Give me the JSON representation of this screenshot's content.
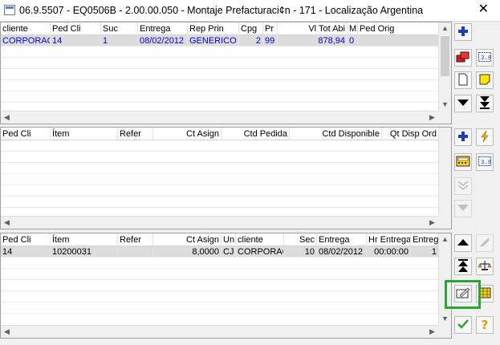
{
  "window": {
    "title": "06.9.5507 - EQ0506B - 2.00.00.050 - Montaje Prefacturaci¢n - 171 - Localização Argentina",
    "close_glyph": "✕"
  },
  "grid_top": {
    "headers": [
      "cliente",
      "Ped Cli",
      "Suc",
      "Entrega",
      "Rep Prin",
      "Cpg",
      "Pr",
      "Vl Tot Abi",
      "M",
      "Ped Orig"
    ],
    "rows": [
      [
        "CORPORAC",
        "14",
        "1",
        "08/02/2012",
        "GENERICO",
        "2",
        "99",
        "878,94",
        "0",
        ""
      ]
    ]
  },
  "grid_middle": {
    "headers": [
      "Ped Cli",
      "Ítem",
      "Refer",
      "Ct Asign",
      "Ctd Pedida",
      "Ctd Disponible",
      "Qt Disp Ord"
    ],
    "rows": []
  },
  "grid_bottom": {
    "headers": [
      "Ped Cli",
      "Ítem",
      "Refer",
      "Ct Asign",
      "Un",
      "cliente",
      "Sec",
      "Entrega",
      "Hr Entrega",
      "Entreg"
    ],
    "rows": [
      [
        "14",
        "10200031",
        "",
        "8,0000",
        "CJ",
        "CORPORAC",
        "10",
        "08/02/2012",
        "00:00:00",
        "1"
      ]
    ]
  },
  "toolbar_icons": {
    "add-icon": "plus",
    "copy-records-icon": "copy",
    "range-icon": "range",
    "new-doc-icon": "doc",
    "note-icon": "note",
    "down-icon": "arrow-down",
    "last-icon": "arrow-last",
    "lightning-icon": "lightning",
    "calculator-icon": "calc",
    "double-down-icon": "chevrons-down",
    "down-filled-icon": "triangle-down",
    "up-icon": "arrow-up",
    "first-icon": "arrow-first",
    "clear-icon": "eraser",
    "rollback-icon": "scale",
    "edit-list-icon": "edit",
    "grid-edit-icon": "grid",
    "confirm-icon": "check",
    "help-icon": "question"
  },
  "colors": {
    "selection_text": "#0000c8",
    "highlight": "#27a836"
  }
}
